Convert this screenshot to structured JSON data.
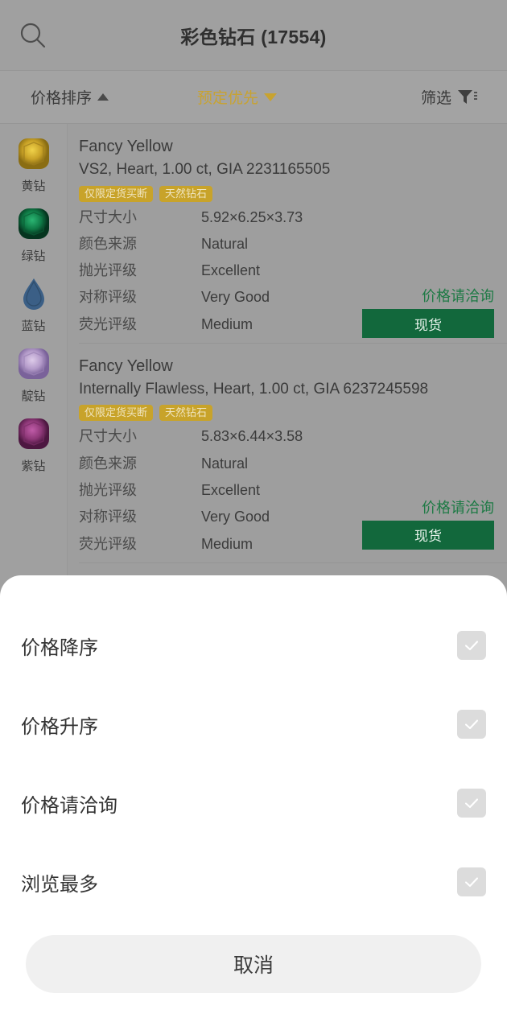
{
  "header": {
    "title": "彩色钻石 (17554)",
    "search_icon": "search-icon"
  },
  "sortbar": {
    "price_sort_label": "价格排序",
    "price_sort_direction_icon": "triangle-up-icon",
    "booking_first_label": "预定优先",
    "booking_first_direction_icon": "triangle-down-icon",
    "filter_label": "筛选",
    "filter_icon": "funnel-icon",
    "active_color": "#c8a330"
  },
  "sidebar": {
    "categories": [
      {
        "label": "黄钻",
        "color": "#c9a227",
        "shape": "cushion",
        "icon": "gem-yellow-icon"
      },
      {
        "label": "绿钻",
        "color": "#0f7a46",
        "shape": "cushion",
        "icon": "gem-green-icon"
      },
      {
        "label": "蓝钻",
        "color": "#3b5f86",
        "shape": "pear",
        "icon": "gem-blue-icon"
      },
      {
        "label": "靛钻",
        "color": "#b39ac9",
        "shape": "cushion",
        "icon": "gem-indigo-icon"
      },
      {
        "label": "紫钻",
        "color": "#8e3878",
        "shape": "cushion",
        "icon": "gem-purple-icon"
      }
    ]
  },
  "list": {
    "spec_keys": {
      "size": "尺寸大小",
      "color_origin": "颜色来源",
      "polish": "抛光评级",
      "symmetry": "对称评级",
      "fluorescence": "荧光评级"
    },
    "items": [
      {
        "title": "Fancy Yellow",
        "subtitle": "VS2, Heart, 1.00 ct, GIA 2231165505",
        "tags": [
          "仅限定货买断",
          "天然钻石"
        ],
        "size": "5.92×6.25×3.73",
        "color_origin": "Natural",
        "polish": "Excellent",
        "symmetry": "Very Good",
        "fluorescence": "Medium",
        "price_note": "价格请洽询",
        "stock_label": "现货"
      },
      {
        "title": "Fancy Yellow",
        "subtitle": "Internally Flawless, Heart, 1.00 ct, GIA 6237245598",
        "tags": [
          "仅限定货买断",
          "天然钻石"
        ],
        "size": "5.83×6.44×3.58",
        "color_origin": "Natural",
        "polish": "Excellent",
        "symmetry": "Very Good",
        "fluorescence": "Medium",
        "price_note": "价格请洽询",
        "stock_label": "现货"
      }
    ]
  },
  "sheet": {
    "options": [
      {
        "label": "价格降序",
        "checked": false
      },
      {
        "label": "价格升序",
        "checked": false
      },
      {
        "label": "价格请洽询",
        "checked": false
      },
      {
        "label": "浏览最多",
        "checked": false
      }
    ],
    "cancel_label": "取消"
  }
}
